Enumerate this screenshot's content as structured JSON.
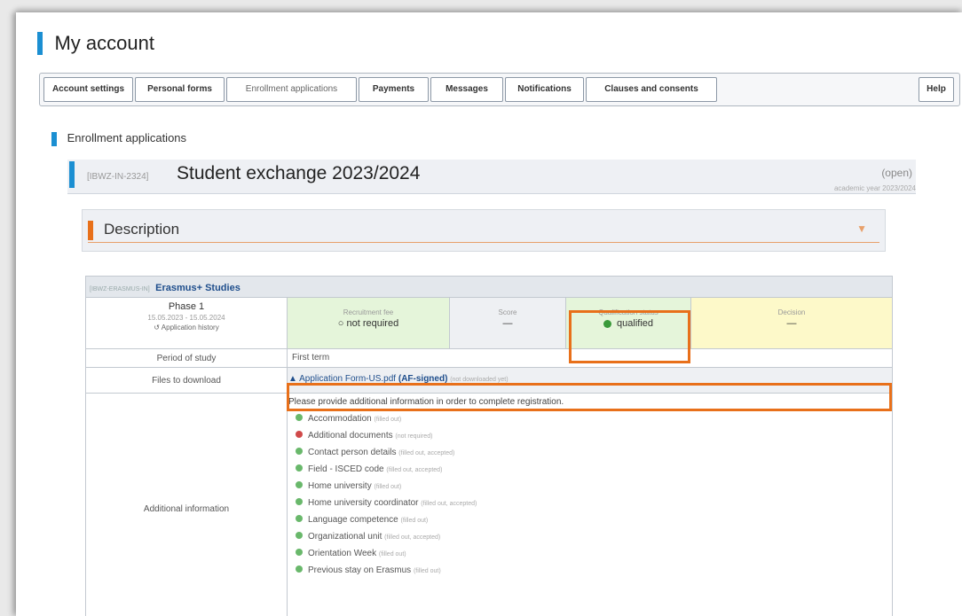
{
  "page_title": "My account",
  "tabs": [
    {
      "label": "Account settings"
    },
    {
      "label": "Personal forms"
    },
    {
      "label": "Enrollment applications"
    },
    {
      "label": "Payments"
    },
    {
      "label": "Messages"
    },
    {
      "label": "Notifications"
    },
    {
      "label": "Clauses and consents"
    }
  ],
  "help_label": "Help",
  "section_title": "Enrollment applications",
  "program": {
    "code": "[IBWZ-IN-2324]",
    "title": "Student exchange 2023/2024",
    "status": "(open)",
    "academic_year": "academic year 2023/2024"
  },
  "description_title": "Description",
  "erasmus": {
    "code": "[IBWZ-ERASMUS-IN]",
    "name": "Erasmus+ Studies",
    "phase": {
      "name": "Phase 1",
      "dates": "15.05.2023 - 15.05.2024",
      "history_link": "Application history"
    },
    "recruitment_fee": {
      "label": "Recruitment fee",
      "value": "not required"
    },
    "score": {
      "label": "Score",
      "value": "—"
    },
    "qualification": {
      "label": "Qualification status",
      "value": "qualified"
    },
    "decision": {
      "label": "Decision",
      "value": "—"
    },
    "period_label": "Period of study",
    "period_value": "First term",
    "files_label": "Files to download",
    "file_name": "Application Form-US.pdf",
    "file_bold": "(AF-signed)",
    "file_note": "(not downloaded yet)",
    "additional_label": "Additional information",
    "additional_intro": "Please provide additional information in order to complete registration.",
    "additional_items": [
      {
        "label": "Accommodation",
        "note": "(filled out)",
        "status": "ok"
      },
      {
        "label": "Additional documents",
        "note": "(not required)",
        "status": "bad"
      },
      {
        "label": "Contact person details",
        "note": "(filled out, accepted)",
        "status": "ok"
      },
      {
        "label": "Field - ISCED code",
        "note": "(filled out, accepted)",
        "status": "ok"
      },
      {
        "label": "Home university",
        "note": "(filled out)",
        "status": "ok"
      },
      {
        "label": "Home university coordinator",
        "note": "(filled out, accepted)",
        "status": "ok"
      },
      {
        "label": "Language competence",
        "note": "(filled out)",
        "status": "ok"
      },
      {
        "label": "Organizational unit",
        "note": "(filled out, accepted)",
        "status": "ok"
      },
      {
        "label": "Orientation Week",
        "note": "(filled out)",
        "status": "ok"
      },
      {
        "label": "Previous stay on Erasmus",
        "note": "(filled out)",
        "status": "ok"
      }
    ]
  },
  "colors": {
    "accent_blue": "#1b8fd2",
    "accent_orange": "#e8701a",
    "ok_green": "#69b86b"
  }
}
